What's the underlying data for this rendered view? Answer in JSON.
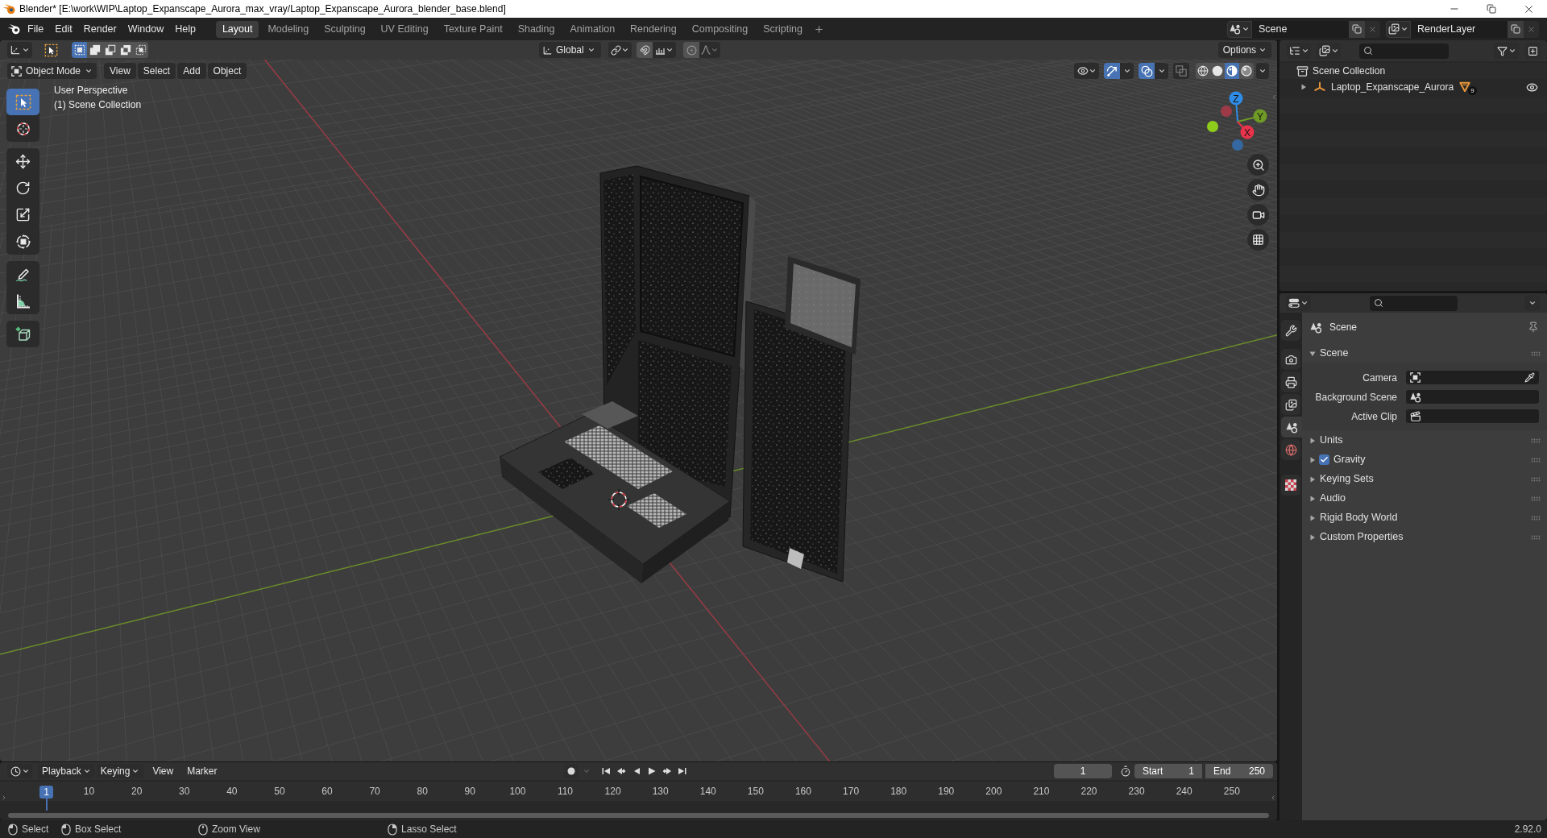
{
  "window": {
    "title": "Blender* [E:\\work\\WIP\\Laptop_Expanscape_Aurora_max_vray/Laptop_Expanscape_Aurora_blender_base.blend]"
  },
  "menu_bar": [
    "File",
    "Edit",
    "Render",
    "Window",
    "Help"
  ],
  "workspace_tabs": [
    {
      "label": "Layout",
      "selected": true
    },
    {
      "label": "Modeling",
      "selected": false
    },
    {
      "label": "Sculpting",
      "selected": false
    },
    {
      "label": "UV Editing",
      "selected": false
    },
    {
      "label": "Texture Paint",
      "selected": false
    },
    {
      "label": "Shading",
      "selected": false
    },
    {
      "label": "Animation",
      "selected": false
    },
    {
      "label": "Rendering",
      "selected": false
    },
    {
      "label": "Compositing",
      "selected": false
    },
    {
      "label": "Scripting",
      "selected": false
    }
  ],
  "scene_selector": {
    "value": "Scene"
  },
  "view_layer_selector": {
    "value": "RenderLayer"
  },
  "tool_header": {
    "select_modes": [
      {
        "kind": "set",
        "selected": true
      },
      {
        "kind": "extend",
        "selected": false
      },
      {
        "kind": "subtract",
        "selected": false
      },
      {
        "kind": "difference",
        "selected": false
      },
      {
        "kind": "intersect",
        "selected": false
      }
    ],
    "orientation": "Global",
    "options": "Options"
  },
  "viewport_header": {
    "mode": "Object Mode",
    "menus": [
      "View",
      "Select",
      "Add",
      "Object"
    ],
    "toggles": [
      {
        "kind": "gizmos",
        "on": true
      },
      {
        "kind": "overlays",
        "on": true
      },
      {
        "kind": "xray",
        "on": false
      }
    ],
    "shading": [
      {
        "kind": "wireframe",
        "selected": false
      },
      {
        "kind": "solid",
        "selected": false
      },
      {
        "kind": "material",
        "selected": true
      },
      {
        "kind": "rendered",
        "selected": false
      }
    ]
  },
  "toolbar": [
    [
      {
        "kind": "select_box",
        "selected": true
      },
      {
        "kind": "cursor",
        "selected": false
      }
    ],
    [
      {
        "kind": "move",
        "selected": false
      },
      {
        "kind": "rotate",
        "selected": false
      },
      {
        "kind": "scale",
        "selected": false
      },
      {
        "kind": "transform",
        "selected": false
      }
    ],
    [
      {
        "kind": "annotate",
        "selected": false
      },
      {
        "kind": "measure",
        "selected": false
      }
    ],
    [
      {
        "kind": "add_cube",
        "selected": false
      }
    ]
  ],
  "view_info": [
    "User Perspective",
    "(1) Scene Collection"
  ],
  "gizmo_axes": [
    {
      "kind": "z",
      "label": "Z"
    },
    {
      "kind": "y",
      "label": "Y"
    },
    {
      "kind": "x",
      "label": "X"
    }
  ],
  "outliner": {
    "items": [
      {
        "label": "Scene Collection",
        "kind": "collection",
        "children": [
          {
            "label": "Laptop_Expanscape_Aurora",
            "kind": "empty",
            "expanded": false,
            "modifier_count": "9",
            "visible": true
          }
        ]
      }
    ]
  },
  "properties": {
    "tab_groups": [
      [
        {
          "kind": "tool",
          "selected": false
        }
      ],
      [
        {
          "kind": "render",
          "selected": false
        },
        {
          "kind": "output",
          "selected": false
        },
        {
          "kind": "view_layer",
          "selected": false
        },
        {
          "kind": "scene",
          "selected": true
        },
        {
          "kind": "world",
          "selected": false
        }
      ],
      [
        {
          "kind": "texture",
          "selected": false
        }
      ]
    ],
    "context": "Scene",
    "panels": [
      {
        "title": "Scene",
        "kind": "plain",
        "expanded": true,
        "fields": [
          {
            "label": "Camera",
            "kind": "camera"
          },
          {
            "label": "Background Scene",
            "kind": "scene"
          },
          {
            "label": "Active Clip",
            "kind": "clip"
          }
        ]
      },
      {
        "title": "Units",
        "kind": "plain",
        "expanded": false
      },
      {
        "title": "Gravity",
        "kind": "toggle",
        "expanded": false,
        "checked": true
      },
      {
        "title": "Keying Sets",
        "kind": "plain",
        "expanded": false
      },
      {
        "title": "Audio",
        "kind": "plain",
        "expanded": false
      },
      {
        "title": "Rigid Body World",
        "kind": "plain",
        "expanded": false
      },
      {
        "title": "Custom Properties",
        "kind": "plain",
        "expanded": false
      }
    ]
  },
  "timeline": {
    "menus": [
      {
        "label": "Playback",
        "kind": "dropdown"
      },
      {
        "label": "Keying",
        "kind": "dropdown"
      },
      {
        "label": "View",
        "kind": "menu"
      },
      {
        "label": "Marker",
        "kind": "menu"
      }
    ],
    "current_frame": "1",
    "start": {
      "label": "Start",
      "value": "1"
    },
    "end": {
      "label": "End",
      "value": "250"
    },
    "ruler_labels": [
      "10",
      "20",
      "30",
      "40",
      "50",
      "60",
      "70",
      "80",
      "90",
      "100",
      "110",
      "120",
      "130",
      "140",
      "150",
      "160",
      "170",
      "180",
      "190",
      "200",
      "210",
      "220",
      "230",
      "240",
      "250"
    ],
    "playhead": "1"
  },
  "status_bar": {
    "hints": [
      {
        "kind": "left_click",
        "label": "Select"
      },
      {
        "kind": "left_drag",
        "label": "Box Select"
      },
      {
        "kind": "middle_click",
        "label": "Zoom View"
      },
      {
        "kind": "right_drag",
        "label": "Lasso Select"
      }
    ],
    "version": "2.92.0"
  }
}
